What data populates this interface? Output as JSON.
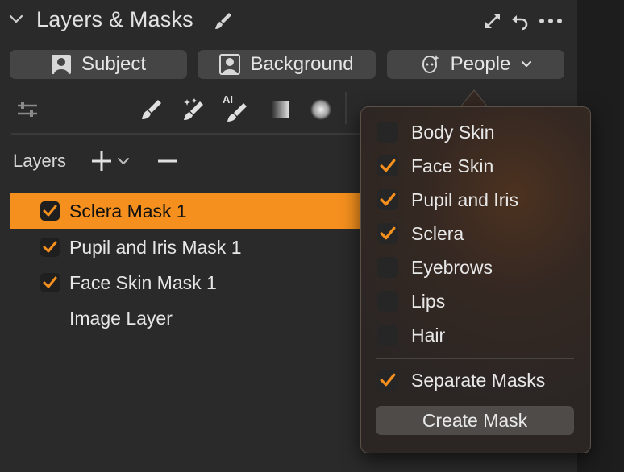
{
  "header": {
    "title": "Layers & Masks"
  },
  "mask_buttons": {
    "subject": "Subject",
    "background": "Background",
    "people": "People"
  },
  "toolbar": {
    "ai_label": "AI"
  },
  "layers": {
    "label": "Layers",
    "items": [
      {
        "name": "Sclera Mask 1",
        "checked": true,
        "selected": true
      },
      {
        "name": "Pupil and Iris Mask 1",
        "checked": true,
        "selected": false
      },
      {
        "name": "Face Skin Mask 1",
        "checked": true,
        "selected": false
      },
      {
        "name": "Image Layer",
        "checked": false,
        "selected": false
      }
    ]
  },
  "people_menu": {
    "items": [
      {
        "label": "Body Skin",
        "checked": false
      },
      {
        "label": "Face Skin",
        "checked": true
      },
      {
        "label": "Pupil and Iris",
        "checked": true
      },
      {
        "label": "Sclera",
        "checked": true
      },
      {
        "label": "Eyebrows",
        "checked": false
      },
      {
        "label": "Lips",
        "checked": false
      },
      {
        "label": "Hair",
        "checked": false
      }
    ],
    "separate_masks": {
      "label": "Separate Masks",
      "checked": true
    },
    "create_label": "Create Mask"
  },
  "colors": {
    "accent": "#f5901e",
    "panel_bg": "#2a2a2a",
    "button_bg": "#454545"
  }
}
